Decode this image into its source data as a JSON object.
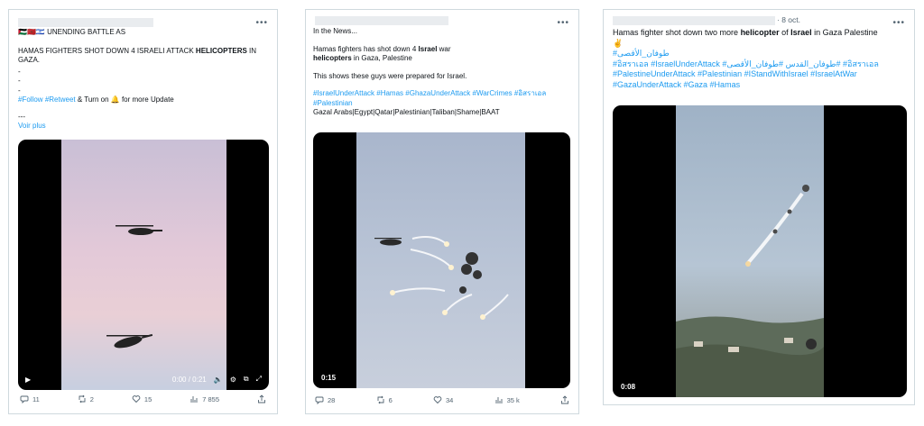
{
  "tweets": [
    {
      "menu_icon": "more-icon",
      "flags": "🇵🇸🇲🇦🇮🇱",
      "header_line": "UNENDING BATTLE AS",
      "body_pre": "HAMAS FIGHTERS SHOT DOWN 4 ISRAELI ATTACK ",
      "body_bold": "HELICOPTERS",
      "body_post": " IN GAZA.",
      "dots": [
        "-",
        "-",
        "-"
      ],
      "tag_follow": "#Follow",
      "tag_retweet": "#Retweet",
      "follow_text": " & Turn on ",
      "bell": "🔔",
      "follow_tail": " for more Update",
      "dash": "---",
      "see_more": "Voir plus",
      "video": {
        "time": "0:00 / 0:21"
      },
      "stats": {
        "replies": "11",
        "retweets": "2",
        "likes": "15",
        "views": "7 855"
      }
    },
    {
      "menu_icon": "more-icon",
      "line1": "In the News...",
      "line2_pre": "Hamas fighters has shot down 4 ",
      "line2_bold": "Israel",
      "line2_post": " war",
      "line3_bold": "helicopters",
      "line3_post": " in Gaza, Palestine",
      "line4": "This shows these guys were prepared for Israel.",
      "hashtags": "#IsraelUnderAttack #Hamas #GhazaUnderAttack #WarCrimes #อิสราเอล #Palestinian",
      "line6": "Gazal Arabs|Egypt|Qatar|Palestinian|Taliban|Shame|BAAT",
      "video": {
        "duration": "0:15"
      },
      "stats": {
        "replies": "28",
        "retweets": "6",
        "likes": "34",
        "views": "35 k"
      }
    },
    {
      "menu_icon": "more-icon",
      "date": "· 8 oct.",
      "line1_pre": "Hamas fighter shot down two more ",
      "line1_bold": "helicopter",
      "line1_mid": " of ",
      "line1_bold2": "Israel",
      "line1_post": " in Gaza Palestine",
      "emoji": "✌️",
      "arabic_tag": "#طوفان_الأقصى",
      "hashtags": "#อิสราเอล #IsraelUnderAttack #طوفان_القدس #طوفان_الأقصى# #อิสราเอล #PalestineUnderAttack #Palestinian #IStandWithIsrael #IsraelAtWar #GazaUnderAttack #Gaza #Hamas",
      "video": {
        "duration": "0:08"
      }
    }
  ],
  "colors": {
    "link": "#1d9bf0",
    "muted": "#536471",
    "border": "#cfd9de"
  }
}
